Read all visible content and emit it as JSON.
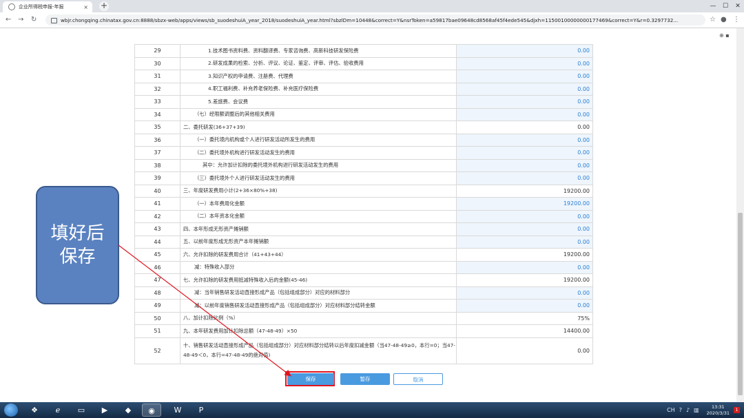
{
  "browser": {
    "tab_title": "企业所得税申报-年报",
    "tab_close": "×",
    "new_tab": "+",
    "url": "wbjr.chongqing.chinatax.gov.cn:8888/sbzx-web/apps/views/sb_suodeshuiA_year_2018/suodeshuiA_year.html?sbzlDm=10448&correct=Y&nsrToken=a59817bae09648cd8568af45f4ede545&djxh=11500100000000177469&correct=Y&r=0.3297732...",
    "window_controls": {
      "minimize": "—",
      "maximize": "☐",
      "close": "✕"
    }
  },
  "table": {
    "rows": [
      {
        "no": "29",
        "label": "1.技术图书资料费、资料翻译费、专家咨询费、高新科技研发保险费",
        "indent": "lv1",
        "value": "0.00",
        "editable": true
      },
      {
        "no": "30",
        "label": "2.研发成果的检索、分析、评议、论证、鉴定、评审、评估、验收费用",
        "indent": "lv1",
        "value": "0.00",
        "editable": true
      },
      {
        "no": "31",
        "label": "3.知识产权的申请费、注册费、代理费",
        "indent": "lv1",
        "value": "0.00",
        "editable": true
      },
      {
        "no": "32",
        "label": "4.职工福利费、补充养老保险费、补充医疗保险费",
        "indent": "lv1",
        "value": "0.00",
        "editable": true
      },
      {
        "no": "33",
        "label": "5.差旅费、会议费",
        "indent": "lv1",
        "value": "0.00",
        "editable": true
      },
      {
        "no": "34",
        "label": "（七）经限额调整后的其他相关费用",
        "indent": "lv2",
        "value": "0.00",
        "editable": true
      },
      {
        "no": "35",
        "label": "二、委托研发(36+37+39)",
        "indent": "",
        "value": "0.00",
        "editable": false
      },
      {
        "no": "36",
        "label": "（一）委托境内机构或个人进行研发活动所发生的费用",
        "indent": "lv2",
        "value": "0.00",
        "editable": true
      },
      {
        "no": "37",
        "label": "（二）委托境外机构进行研发活动发生的费用",
        "indent": "lv2",
        "value": "0.00",
        "editable": true
      },
      {
        "no": "38",
        "label": "其中：允许加计扣除的委托境外机构进行研发活动发生的费用",
        "indent": "lv3",
        "value": "0.00",
        "editable": true
      },
      {
        "no": "39",
        "label": "（三）委托境外个人进行研发活动发生的费用",
        "indent": "lv2",
        "value": "0.00",
        "editable": true
      },
      {
        "no": "40",
        "label": "三、年度研发费用小计(2+36×80%+38)",
        "indent": "",
        "value": "19200.00",
        "editable": false
      },
      {
        "no": "41",
        "label": "（一）本年费用化金额",
        "indent": "lv2",
        "value": "19200.00",
        "editable": true
      },
      {
        "no": "42",
        "label": "（二）本年资本化金额",
        "indent": "lv2",
        "value": "0.00",
        "editable": true
      },
      {
        "no": "43",
        "label": "四、本年形成无形资产摊销额",
        "indent": "",
        "value": "0.00",
        "editable": true
      },
      {
        "no": "44",
        "label": "五、以前年度形成无形资产本年摊销额",
        "indent": "",
        "value": "0.00",
        "editable": true
      },
      {
        "no": "45",
        "label": "六、允许扣除的研发费用合计（41+43+44）",
        "indent": "",
        "value": "19200.00",
        "editable": false
      },
      {
        "no": "46",
        "label": "减：特殊收入部分",
        "indent": "lv2",
        "value": "0.00",
        "editable": true
      },
      {
        "no": "47",
        "label": "七、允许扣除的研发费用抵减特殊收入后的金额(45-46)",
        "indent": "",
        "value": "19200.00",
        "editable": false
      },
      {
        "no": "48",
        "label": "减：当年销售研发活动直接形成产品（包括组成部分）对应的材料部分",
        "indent": "lv2",
        "value": "0.00",
        "editable": true
      },
      {
        "no": "49",
        "label": "减：以前年度销售研发活动直接形成产品（包括组成部分）对应材料部分结转金额",
        "indent": "lv2",
        "value": "0.00",
        "editable": true
      },
      {
        "no": "50",
        "label": "八、加计扣除比例（%）",
        "indent": "",
        "value": "75%",
        "editable": false
      },
      {
        "no": "51",
        "label": "九、本年研发费用加计扣除总额（47-48-49）×50",
        "indent": "",
        "value": "14400.00",
        "editable": false
      },
      {
        "no": "52",
        "label": "十、销售研发活动直接形成产品（包括组成部分）对应材料部分结转以后年度扣减金额（当47-48-49≥0，本行=0；当47-48-49＜0，本行=47-48-49的绝对值)",
        "indent": "",
        "value": "0.00",
        "editable": false,
        "wrap": true
      }
    ]
  },
  "buttons": {
    "save": "保存",
    "draft": "暂存",
    "cancel": "取消"
  },
  "callout": {
    "text": "填好后保存"
  },
  "taskbar": {
    "lang": "CH",
    "time": "13:31",
    "date": "2020/3/31",
    "notification_count": "1"
  },
  "colors": {
    "accent": "#4a9ae0",
    "highlight": "#e0141e",
    "callout_bg": "#5b82c0"
  }
}
